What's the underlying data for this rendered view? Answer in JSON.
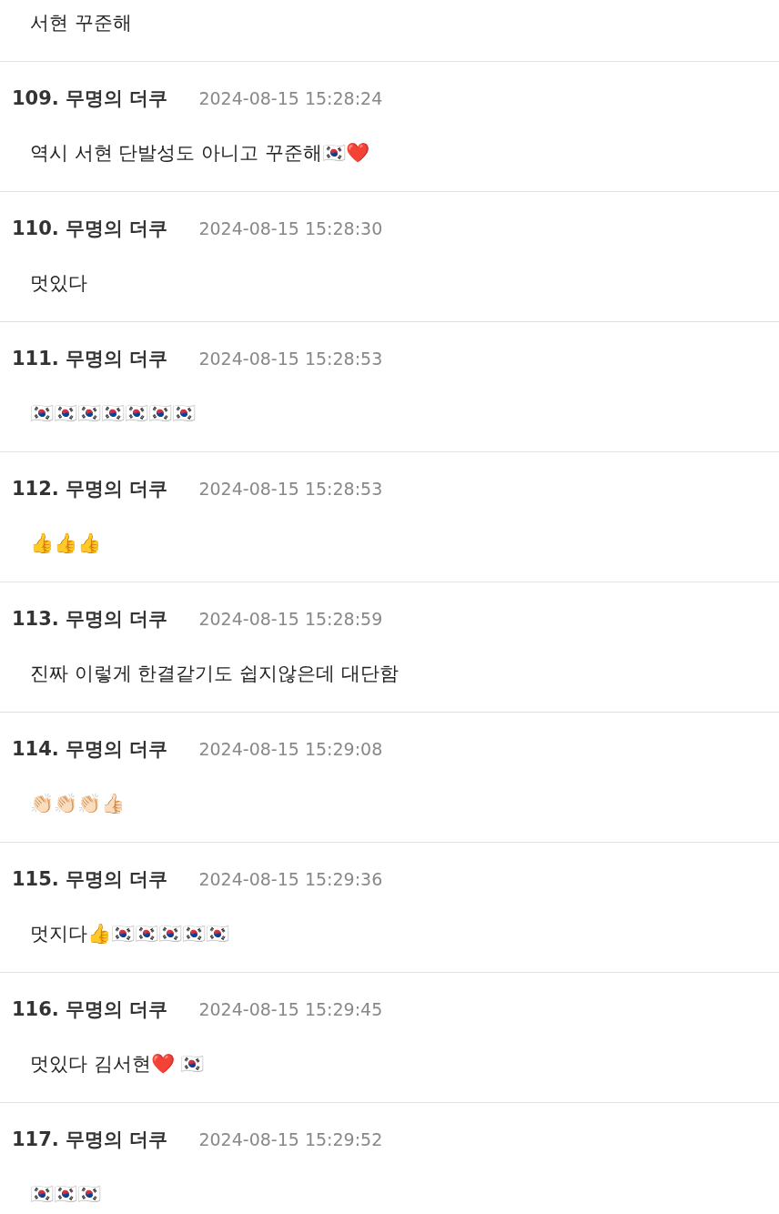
{
  "comments": [
    {
      "body": "서현 꾸준해"
    },
    {
      "number": "109.",
      "author": "무명의 더쿠",
      "time": "2024-08-15 15:28:24",
      "body": "역시 서현 단발성도 아니고 꾸준해🇰🇷❤️"
    },
    {
      "number": "110.",
      "author": "무명의 더쿠",
      "time": "2024-08-15 15:28:30",
      "body": "멋있다"
    },
    {
      "number": "111.",
      "author": "무명의 더쿠",
      "time": "2024-08-15 15:28:53",
      "body": "🇰🇷🇰🇷🇰🇷🇰🇷🇰🇷🇰🇷🇰🇷"
    },
    {
      "number": "112.",
      "author": "무명의 더쿠",
      "time": "2024-08-15 15:28:53",
      "body": "👍👍👍"
    },
    {
      "number": "113.",
      "author": "무명의 더쿠",
      "time": "2024-08-15 15:28:59",
      "body": "진짜 이렇게 한결같기도 쉽지않은데 대단함"
    },
    {
      "number": "114.",
      "author": "무명의 더쿠",
      "time": "2024-08-15 15:29:08",
      "body": "👏🏻👏🏻👏🏻👍🏻"
    },
    {
      "number": "115.",
      "author": "무명의 더쿠",
      "time": "2024-08-15 15:29:36",
      "body": "멋지다👍🇰🇷🇰🇷🇰🇷🇰🇷🇰🇷"
    },
    {
      "number": "116.",
      "author": "무명의 더쿠",
      "time": "2024-08-15 15:29:45",
      "body": "멋있다 김서현❤️ 🇰🇷"
    },
    {
      "number": "117.",
      "author": "무명의 더쿠",
      "time": "2024-08-15 15:29:52",
      "body": "🇰🇷🇰🇷🇰🇷"
    }
  ]
}
